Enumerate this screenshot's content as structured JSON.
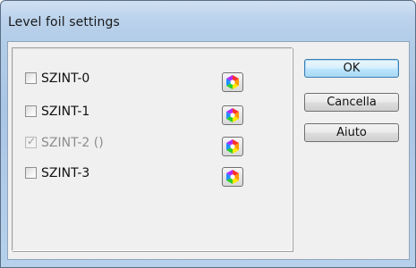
{
  "window": {
    "title": "Level foil settings"
  },
  "items": [
    {
      "label": "SZINT-0",
      "checked": false,
      "disabled": false
    },
    {
      "label": "SZINT-1",
      "checked": false,
      "disabled": false
    },
    {
      "label": "SZINT-2 ()",
      "checked": true,
      "disabled": true
    },
    {
      "label": "SZINT-3",
      "checked": false,
      "disabled": false
    }
  ],
  "buttons": {
    "ok": "OK",
    "cancel": "Cancella",
    "help": "Aiuto"
  },
  "icons": {
    "color_picker": "color-wheel-icon",
    "checkmark": "checkmark-icon"
  },
  "colors": {
    "title_bar": "#bcd3ec",
    "client_bg": "#f0f0f0",
    "default_button": "#bee6fd"
  }
}
